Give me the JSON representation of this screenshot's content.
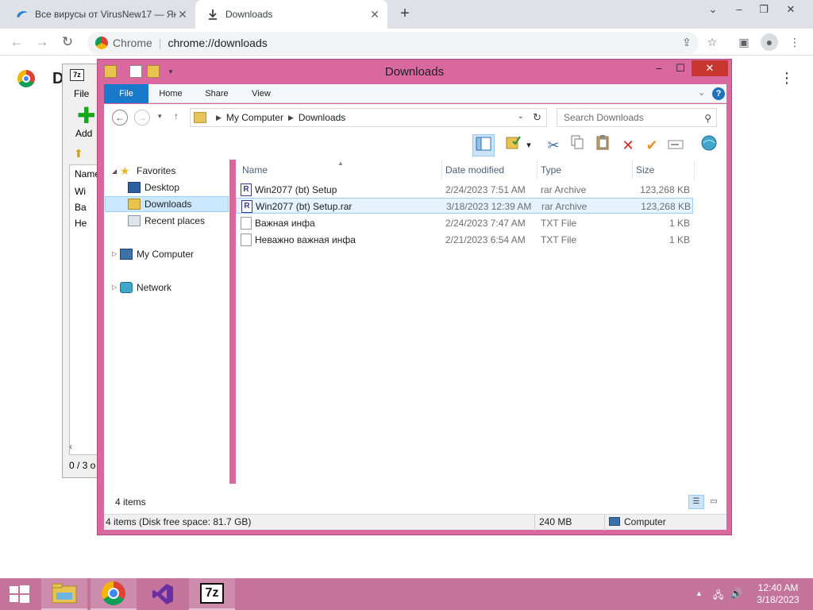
{
  "browser": {
    "tabs": [
      {
        "title": "Все вирусы от VirusNew17 — Ян",
        "favicon": "yandex-disk-icon",
        "active": false
      },
      {
        "title": "Downloads",
        "favicon": "download-icon",
        "active": true
      }
    ],
    "new_tab": "+",
    "omnibox": {
      "scheme_label": "Chrome",
      "url": "chrome://downloads"
    },
    "page_title_fragment": "D"
  },
  "sevenzip": {
    "title_icon": "7z",
    "menu_file": "File",
    "add_label": "Add",
    "column_name": "Name",
    "rows": [
      "Wi",
      "Ва",
      "He"
    ],
    "status": "0 / 3 o"
  },
  "explorer": {
    "title": "Downloads",
    "ribbon_tabs": [
      "File",
      "Home",
      "Share",
      "View"
    ],
    "help": "?",
    "breadcrumb": [
      "My Computer",
      "Downloads"
    ],
    "search_placeholder": "Search Downloads",
    "nav": {
      "favorites": "Favorites",
      "desktop": "Desktop",
      "downloads": "Downloads",
      "recent": "Recent places",
      "computer": "My Computer",
      "network": "Network"
    },
    "columns": {
      "name": "Name",
      "date": "Date modified",
      "type": "Type",
      "size": "Size"
    },
    "files": [
      {
        "name": "Win2077 (bt) Setup",
        "date": "2/24/2023 7:51 AM",
        "type": "rar Archive",
        "size": "123,268 KB",
        "icon": "rar-icon"
      },
      {
        "name": "Win2077 (bt) Setup.rar",
        "date": "3/18/2023 12:39 AM",
        "type": "rar Archive",
        "size": "123,268 KB",
        "icon": "rar-icon"
      },
      {
        "name": "Важная инфа",
        "date": "2/24/2023 7:47 AM",
        "type": "TXT File",
        "size": "1 KB",
        "icon": "text-file-icon"
      },
      {
        "name": "Неважно важная инфа",
        "date": "2/21/2023 6:54 AM",
        "type": "TXT File",
        "size": "1 KB",
        "icon": "text-file-icon"
      }
    ],
    "selected_index": 1,
    "items_count": "4 items",
    "status": {
      "left": "4 items (Disk free space: 81.7 GB)",
      "middle": "240 MB",
      "right": "Computer"
    }
  },
  "taskbar": {
    "apps": [
      "file-explorer-icon",
      "chrome-icon",
      "visual-studio-icon",
      "7zip-icon"
    ],
    "sevenzip_label": "7z",
    "time": "12:40 AM",
    "date": "3/18/2023"
  },
  "colors": {
    "explorer_frame": "#d9689e",
    "taskbar": "#c4739a",
    "ribbon_file": "#1979ca",
    "close_button": "#c7372f",
    "selection": "#cce8ff"
  }
}
